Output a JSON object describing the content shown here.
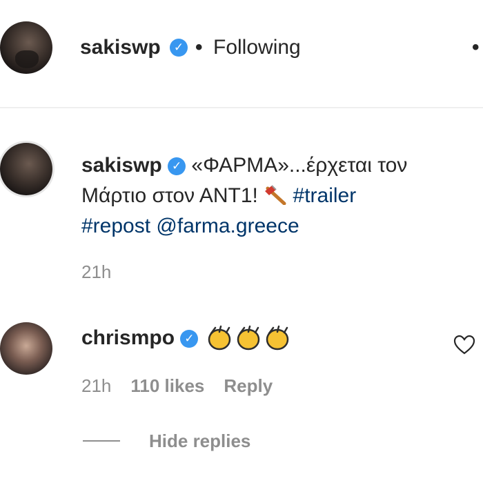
{
  "header": {
    "username": "sakiswp",
    "verified_mark": "✓",
    "dot": "•",
    "follow_status": "Following",
    "more": "•"
  },
  "caption": {
    "username": "sakiswp",
    "verified_mark": "✓",
    "text_line1": "«ΦΑΡΜΑ»...έρχεται τον",
    "text_line2": "Μάρτιο στον ΑΝΤ1!",
    "hashtag_trailer": "#trailer",
    "hashtag_repost": "#repost",
    "mention": "@farma.greece",
    "time": "21h"
  },
  "comment": {
    "username": "chrismpo",
    "verified_mark": "✓",
    "time": "21h",
    "likes": "110 likes",
    "reply": "Reply",
    "hide_replies": "Hide replies"
  },
  "colors": {
    "verified": "#3897f0",
    "hashtag": "#003569",
    "muted": "#8e8e8e"
  },
  "icons": [
    "verified-badge-icon",
    "axe-emoji-icon",
    "clapping-hands-emoji-icon",
    "heart-icon"
  ]
}
